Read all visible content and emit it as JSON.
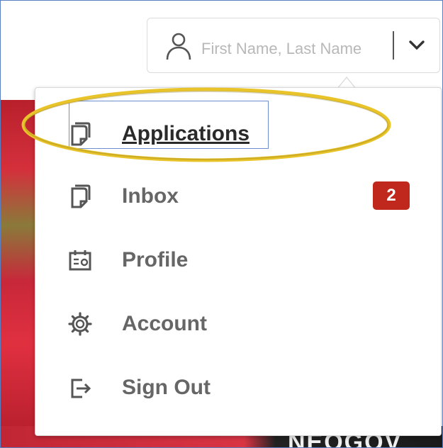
{
  "header": {
    "user_placeholder": "First Name, Last Name"
  },
  "menu": {
    "items": [
      {
        "label": "Applications",
        "icon": "document-icon"
      },
      {
        "label": "Inbox",
        "icon": "document-icon",
        "badge": "2"
      },
      {
        "label": "Profile",
        "icon": "profile-card-icon"
      },
      {
        "label": "Account",
        "icon": "gear-icon"
      },
      {
        "label": "Sign Out",
        "icon": "sign-out-icon"
      }
    ]
  },
  "background": {
    "logo_text": "NEOGOV"
  },
  "colors": {
    "badge": "#c0281e",
    "highlight_ring": "#e8c42a",
    "focus_outline": "#6d8fd0",
    "menu_text": "#666666"
  }
}
